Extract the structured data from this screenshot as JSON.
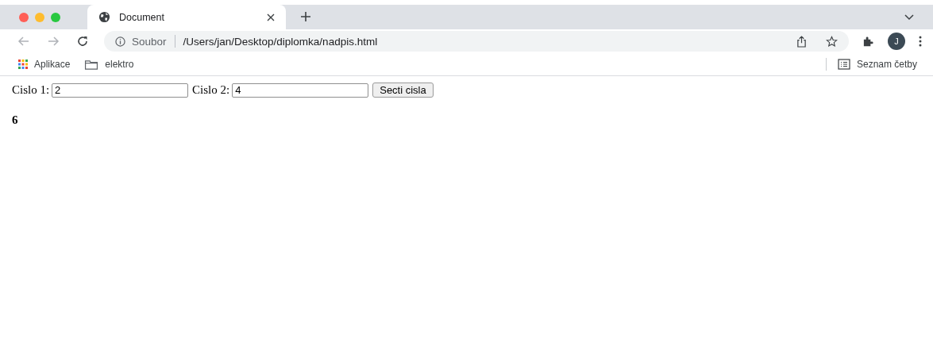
{
  "tabs": [
    {
      "title": "Document",
      "selected": true
    }
  ],
  "address_bar": {
    "scheme": "Soubor",
    "url": "/Users/jan/Desktop/diplomka/nadpis.html"
  },
  "profile": {
    "initial": "J"
  },
  "bookmarks": [
    {
      "label": "Aplikace",
      "kind": "apps"
    },
    {
      "label": "elektro",
      "kind": "folder"
    }
  ],
  "reading_list": {
    "label": "Seznam četby"
  },
  "form": {
    "fields": [
      {
        "label": "Cislo 1:",
        "value": "2"
      },
      {
        "label": "Cislo 2:",
        "value": "4"
      }
    ],
    "button": "Secti cisla"
  },
  "result": "6"
}
